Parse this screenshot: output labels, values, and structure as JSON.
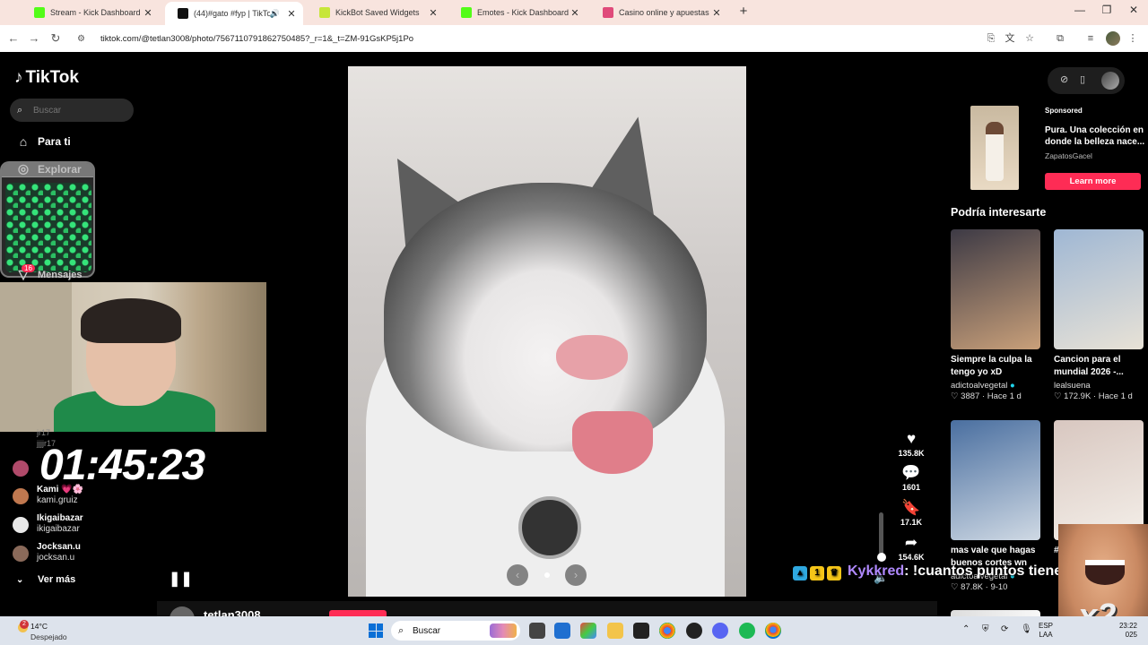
{
  "browser": {
    "tabs": [
      {
        "label": "Stream - Kick Dashboard",
        "favicon_color": "#53fc18",
        "active": false
      },
      {
        "label": "(44)#gato #fyp | TikTok",
        "favicon_color": "#111111",
        "active": true
      },
      {
        "label": "KickBot Saved Widgets",
        "favicon_color": "#c7e63a",
        "active": false
      },
      {
        "label": "Emotes - Kick Dashboard",
        "favicon_color": "#53fc18",
        "active": false
      },
      {
        "label": "Casino online y apuestas depo",
        "favicon_color": "#e04a7a",
        "active": false
      }
    ],
    "url": "tiktok.com/@tetlan3008/photo/7567110791862750485?_r=1&_t=ZM-91GsKP5j1Po"
  },
  "sidebar": {
    "logo": "TikTok",
    "search_placeholder": "Buscar",
    "nav": [
      {
        "label": "Para ti",
        "icon": "home-icon"
      },
      {
        "label": "Explorar",
        "icon": "compass-icon"
      },
      {
        "label": "Mensajes",
        "icon": "message-icon"
      }
    ],
    "messages_badge": "16"
  },
  "overlay": {
    "timer": "01:45:23",
    "faded_lines": [
      "jr17",
      "jjjjr17"
    ],
    "users": [
      {
        "name": "",
        "handle": "",
        "avatar_color": "#b04a6a"
      },
      {
        "name": "Kami 💗🌸",
        "handle": "kami.gruiz",
        "avatar_color": "#c0784f"
      },
      {
        "name": "Ikigaibazar",
        "handle": "ikigaibazar",
        "avatar_color": "#e8e8e8"
      },
      {
        "name": "Jocksan.u",
        "handle": "jocksan.u",
        "avatar_color": "#8a6a5a"
      }
    ],
    "ver_mas": "Ver más",
    "chat_name": "Kykkred",
    "chat_message": ": !cuantos puntos tienes Camilo",
    "multiplier": "x2"
  },
  "post": {
    "author": "tetlan3008",
    "actions": [
      {
        "icon": "heart-icon",
        "count": "135.8K"
      },
      {
        "icon": "comment-icon",
        "count": "1601"
      },
      {
        "icon": "bookmark-icon",
        "count": "17.1K"
      },
      {
        "icon": "share-icon",
        "count": "154.6K"
      }
    ]
  },
  "right_panel": {
    "sponsored_label": "Sponsored",
    "ad_text": "Pura. Una colección en donde la belleza nace...",
    "ad_brand": "ZapatosGacel",
    "learn_more": "Learn more",
    "section_title": "Podría interesarte",
    "recommendations": [
      {
        "title": "Siempre la culpa la tengo yo xD",
        "author": "adictoalvegetal",
        "verified": true,
        "likes": "3887",
        "age": "Hace 1 d",
        "thumb_colors": [
          "#3d3a45",
          "#c9a07a"
        ]
      },
      {
        "title": "Cancion para el mundial 2026 -...",
        "author": "lealsuena",
        "verified": false,
        "likes": "172.9K",
        "age": "Hace 1 d",
        "thumb_colors": [
          "#9fb7d4",
          "#e8e2d6"
        ]
      },
      {
        "title": "mas vale que hagas buenos cortes wn",
        "author": "adictoalvegetal",
        "verified": true,
        "likes": "87.8K",
        "age": "9-10",
        "thumb_colors": [
          "#4a6fa0",
          "#cfd9e4"
        ]
      },
      {
        "title": "#",
        "author": "",
        "verified": false,
        "likes": "",
        "age": "",
        "thumb_colors": [
          "#d8c7c0",
          "#f4efe9"
        ]
      }
    ]
  },
  "taskbar": {
    "temperature": "14°C",
    "weather": "Despejado",
    "weather_badge": "2",
    "search_label": "Buscar",
    "lang_top": "ESP",
    "lang_bottom": "LAA",
    "time": "23:22",
    "date": "025"
  }
}
